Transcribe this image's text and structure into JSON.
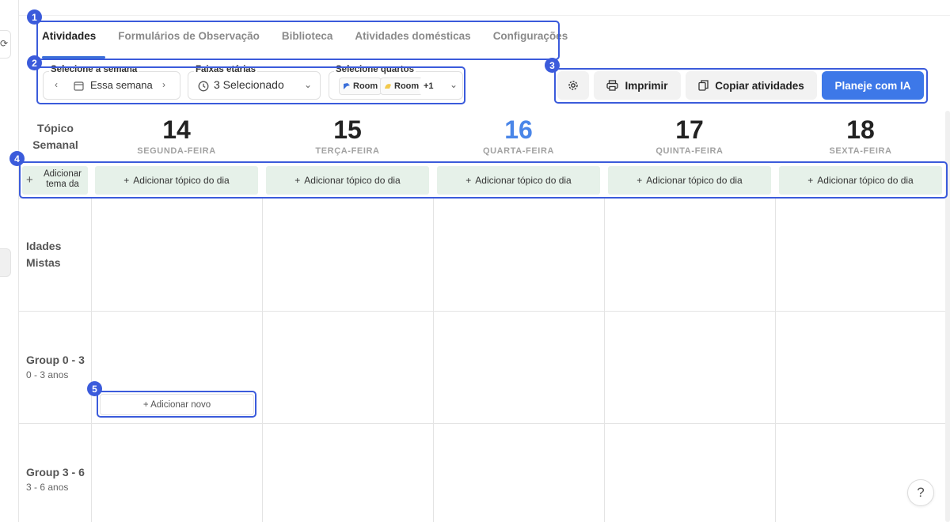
{
  "tabs": [
    {
      "label": "Atividades",
      "active": true
    },
    {
      "label": "Formulários de Observação",
      "active": false
    },
    {
      "label": "Biblioteca",
      "active": false
    },
    {
      "label": "Atividades domésticas",
      "active": false
    },
    {
      "label": "Configurações",
      "active": false
    }
  ],
  "filters": {
    "week": {
      "label": "Selecione a semana",
      "value": "Essa semana"
    },
    "age": {
      "label": "Faixas etárias",
      "value": "3 Selecionado"
    },
    "rooms": {
      "label": "Selecione quartos",
      "chips": [
        "Room",
        "Room"
      ],
      "more": "+1"
    }
  },
  "actions": {
    "print": "Imprimir",
    "copy": "Copiar atividades",
    "plan_ai": "Planeje com IA"
  },
  "calendar": {
    "topic_header": "Tópico Semanal",
    "add_theme": "Adicionar tema da",
    "add_day_topic": "Adicionar tópico do dia",
    "days": [
      {
        "num": "14",
        "name": "SEGUNDA-FEIRA",
        "today": false
      },
      {
        "num": "15",
        "name": "TERÇA-FEIRA",
        "today": false
      },
      {
        "num": "16",
        "name": "QUARTA-FEIRA",
        "today": true
      },
      {
        "num": "17",
        "name": "QUINTA-FEIRA",
        "today": false
      },
      {
        "num": "18",
        "name": "SEXTA-FEIRA",
        "today": false
      }
    ],
    "groups": [
      {
        "name": "Idades Mistas",
        "sub": ""
      },
      {
        "name": "Group 0 - 3",
        "sub": "0 - 3 anos"
      },
      {
        "name": "Group 3 - 6",
        "sub": "3 - 6 anos"
      }
    ],
    "add_new": "+ Adicionar novo"
  },
  "annotations": [
    "1",
    "2",
    "3",
    "4",
    "5"
  ],
  "help": "?",
  "colors": {
    "accent": "#3b6fd9",
    "primary_button": "#3d78e8",
    "today": "#4a86e8",
    "annotation": "#3b5bdb",
    "topic_cell": "#e6f1e9"
  }
}
